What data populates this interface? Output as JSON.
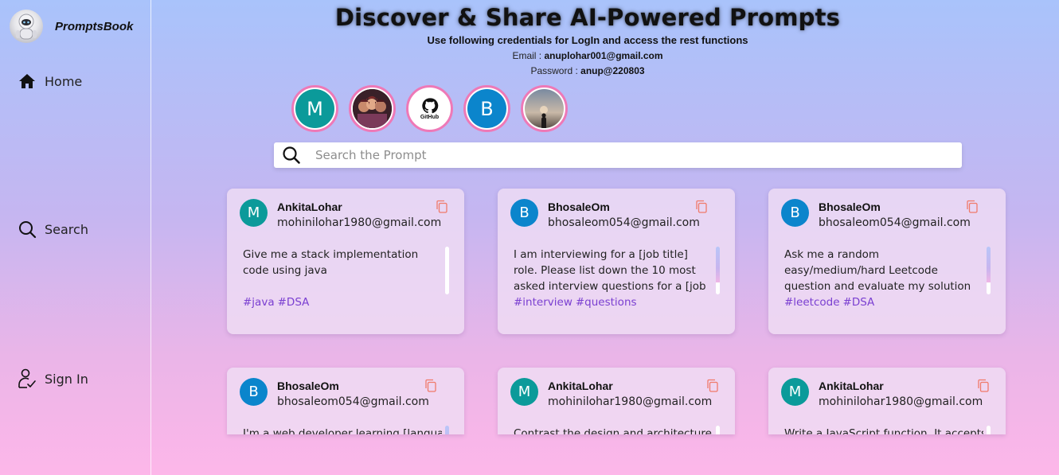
{
  "brand": {
    "title": "PromptsBook",
    "logo_icon": "robot-logo"
  },
  "nav": [
    {
      "label": "Home",
      "icon": "home-icon"
    },
    {
      "label": "Search",
      "icon": "search-icon"
    },
    {
      "label": "Sign In",
      "icon": "user-check-icon"
    }
  ],
  "header": {
    "title": "Discover & Share AI-Powered Prompts",
    "subtitle": "Use following credentials for LogIn and access the rest functions",
    "email_label": "Email :",
    "email_value": "anuplohar001@gmail.com",
    "password_label": "Password :",
    "password_value": "anup@220803"
  },
  "avatars": [
    {
      "letter": "M",
      "color": "#0b9a9a"
    },
    {
      "letter": "",
      "kind": "photo-group"
    },
    {
      "letter": "",
      "kind": "github",
      "text": "GitHub"
    },
    {
      "letter": "B",
      "color": "#0b85cc"
    },
    {
      "letter": "",
      "kind": "photo-person"
    }
  ],
  "search": {
    "placeholder": "Search the Prompt",
    "value": ""
  },
  "colors": {
    "accent_pink": "#ee79b7",
    "tag_purple": "#7a3fd1",
    "teal": "#0b9a9a",
    "blue": "#0b85cc",
    "copy_icon": "#f07a6a"
  },
  "cards": [
    {
      "initial": "M",
      "name": "AnkitaLohar",
      "email": "mohinilohar1980@gmail.com",
      "prompt": "Give me a stack implementation code using java",
      "tags": [
        "#java",
        "#DSA"
      ]
    },
    {
      "initial": "B",
      "name": "BhosaleOm",
      "email": "bhosaleom054@gmail.com",
      "prompt": "I am interviewing for a [job title] role. Please list down the 10 most asked interview questions for a [job title]",
      "tags": [
        "#interview",
        "#questions"
      ]
    },
    {
      "initial": "B",
      "name": "BhosaleOm",
      "email": "bhosaleom054@gmail.com",
      "prompt": "Ask me a random easy/medium/hard Leetcode question and evaluate my solution based on correctness, and the",
      "tags": [
        "#leetcode",
        "#DSA"
      ]
    },
    {
      "initial": "B",
      "name": "BhosaleOm",
      "email": "bhosaleom054@gmail.com",
      "prompt": "I'm a web developer learning [language/",
      "tags": []
    },
    {
      "initial": "M",
      "name": "AnkitaLohar",
      "email": "mohinilohar1980@gmail.com",
      "prompt": "Contrast the design and architecture",
      "tags": []
    },
    {
      "initial": "M",
      "name": "AnkitaLohar",
      "email": "mohinilohar1980@gmail.com",
      "prompt": "Write a JavaScript function. It accepts a",
      "tags": []
    }
  ]
}
